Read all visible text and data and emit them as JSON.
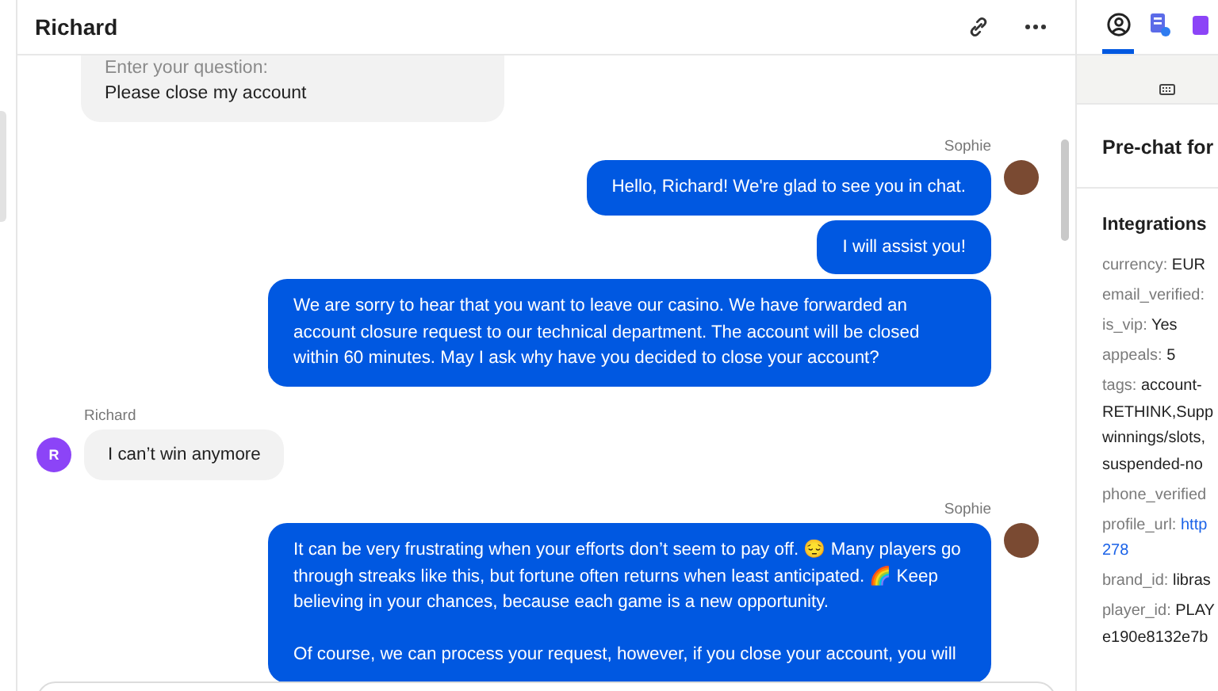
{
  "header": {
    "title": "Richard"
  },
  "messages": [
    {
      "kind": "form",
      "items": [
        {
          "label": "Enter your question:",
          "value": "Please close my account"
        }
      ]
    },
    {
      "kind": "agent",
      "author": "Sophie",
      "bubbles": [
        "Hello, Richard! We're glad to see you in chat.",
        "I will assist you!",
        "We are sorry to hear that you want to leave our casino. We have forwarded an account closure request to our technical department. The account will be closed within 60 minutes. May I ask why have you decided to close your account?"
      ]
    },
    {
      "kind": "visitor",
      "author": "Richard",
      "avatar": "R",
      "bubbles": [
        "I can’t win anymore"
      ]
    },
    {
      "kind": "agent",
      "author": "Sophie",
      "bubbles": [
        "It can be very frustrating when your efforts don’t seem to pay off. 😔 Many players go through streaks like this, but fortune often returns when least anticipated. 🌈 Keep believing in your chances, because each game is a new opportunity.\n\nOf course, we can process your request, however, if you close your account, you will"
      ]
    }
  ],
  "side_panel": {
    "tabs": [
      {
        "kind": "profile",
        "selected": true
      },
      {
        "kind": "notes",
        "selected": false
      },
      {
        "kind": "apps",
        "selected": false
      }
    ],
    "sections": [
      {
        "title": "Pre-chat for"
      }
    ],
    "integrations": {
      "title": "Integrations",
      "fields": [
        {
          "key": "currency:",
          "lines": [
            "EUR"
          ],
          "link": false
        },
        {
          "key": "email_verified:"
        },
        {
          "key": "is_vip:",
          "lines": [
            "Yes"
          ],
          "link": false
        },
        {
          "key": "appeals:",
          "lines": [
            "5"
          ],
          "link": false
        },
        {
          "key": "tags:",
          "lines": [
            "account-",
            "RETHINK,Supp",
            "winnings/slots,",
            "suspended-no"
          ],
          "link": false
        },
        {
          "key": "phone_verified"
        },
        {
          "key": "profile_url:",
          "lines": [
            "http",
            "278"
          ],
          "link": true
        },
        {
          "key": "brand_id:",
          "lines": [
            "libras"
          ],
          "link": false
        },
        {
          "key": "player_id:",
          "lines": [
            "PLAY",
            "e190e8132e7b"
          ],
          "link": false
        }
      ]
    }
  }
}
